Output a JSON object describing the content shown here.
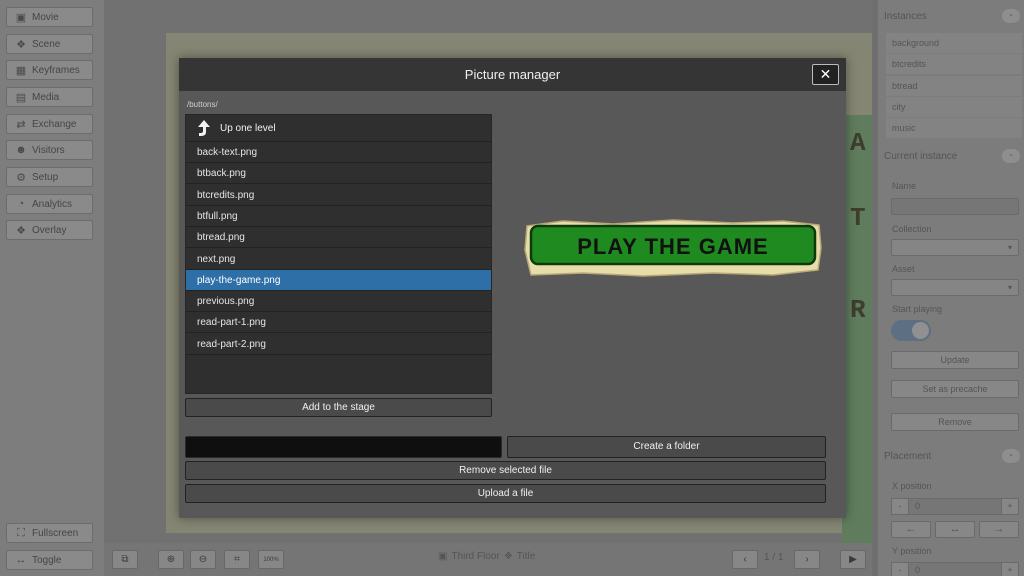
{
  "sidebar": {
    "items": [
      {
        "label": "Movie",
        "icon": "film-icon"
      },
      {
        "label": "Scene",
        "icon": "scene-icon"
      },
      {
        "label": "Keyframes",
        "icon": "grid-icon"
      },
      {
        "label": "Media",
        "icon": "image-icon"
      },
      {
        "label": "Exchange",
        "icon": "exchange-icon"
      },
      {
        "label": "Visitors",
        "icon": "users-icon"
      },
      {
        "label": "Setup",
        "icon": "gear-icon"
      },
      {
        "label": "Analytics",
        "icon": "chart-icon"
      },
      {
        "label": "Overlay",
        "icon": "overlay-icon"
      }
    ],
    "bottom": [
      {
        "label": "Fullscreen",
        "icon": "fullscreen-icon"
      },
      {
        "label": "Toggle",
        "icon": "toggle-arrows-icon"
      }
    ]
  },
  "bottombar": {
    "zoom_label": "100%",
    "breadcrumb_scene": "Third Floor",
    "breadcrumb_keyframe": "Title",
    "pager": "1 / 1"
  },
  "right_panel": {
    "instances_title": "Instances",
    "instances": [
      "background",
      "btcredits",
      "btread",
      "city",
      "music"
    ],
    "current_title": "Current instance",
    "name_label": "Name",
    "collection_label": "Collection",
    "asset_label": "Asset",
    "start_playing_label": "Start playing",
    "update_label": "Update",
    "precache_label": "Set as precache",
    "remove_label": "Remove",
    "placement_title": "Placement",
    "x_label": "X position",
    "x_value": "0",
    "y_label": "Y position",
    "y_value": "0",
    "minus": "-",
    "plus": "+"
  },
  "modal": {
    "title": "Picture manager",
    "close": "✕",
    "path": "/buttons/",
    "up_label": "Up one level",
    "files": [
      "back-text.png",
      "btback.png",
      "btcredits.png",
      "btfull.png",
      "btread.png",
      "next.png",
      "play-the-game.png",
      "previous.png",
      "read-part-1.png",
      "read-part-2.png"
    ],
    "selected_index": 6,
    "add_label": "Add to the stage",
    "create_folder_label": "Create a folder",
    "remove_file_label": "Remove selected file",
    "upload_label": "Upload a file",
    "preview_text": "PLAY THE GAME"
  },
  "colors": {
    "accent": "#2f6fa8",
    "preview_green": "#1f8a1f",
    "preview_paper": "#e8dca8"
  }
}
